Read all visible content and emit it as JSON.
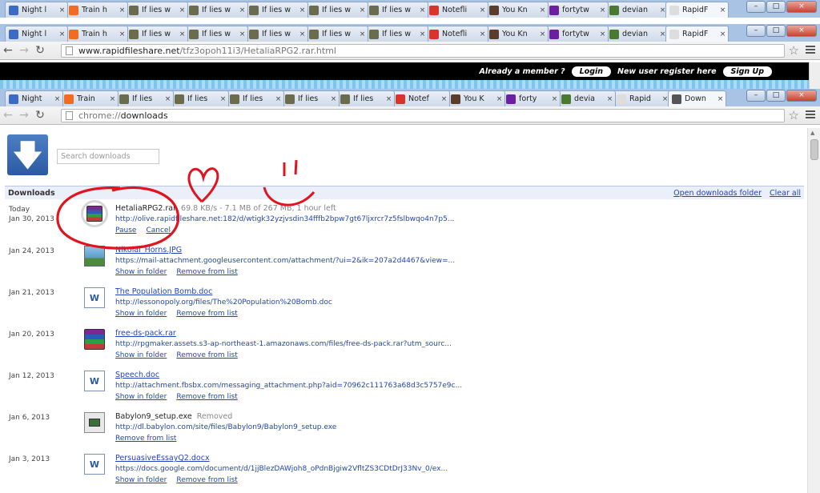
{
  "browser_outer": {
    "tabs": [
      {
        "label": "Night l",
        "icon": "doc-icon",
        "color": "#3b6bc4"
      },
      {
        "label": "Train h",
        "icon": "blogger-icon",
        "color": "#f26b22"
      },
      {
        "label": "If lies w",
        "icon": "thumbnail-icon",
        "color": "#6b6b4e"
      },
      {
        "label": "If lies w",
        "icon": "thumbnail-icon",
        "color": "#6b6b4e"
      },
      {
        "label": "If lies w",
        "icon": "thumbnail-icon",
        "color": "#6b6b4e"
      },
      {
        "label": "If lies w",
        "icon": "thumbnail-icon",
        "color": "#6b6b4e"
      },
      {
        "label": "If lies w",
        "icon": "thumbnail-icon",
        "color": "#6b6b4e"
      },
      {
        "label": "Notefli",
        "icon": "notefli-icon",
        "color": "#d9342b"
      },
      {
        "label": "You Kn",
        "icon": "photo-icon",
        "color": "#5a3d2b"
      },
      {
        "label": "fortytw",
        "icon": "yahoo-icon",
        "color": "#6b1fa3"
      },
      {
        "label": "devian",
        "icon": "deviantart-icon",
        "color": "#4a7a32"
      },
      {
        "label": "RapidF",
        "icon": "page-icon",
        "color": "#dddddd"
      }
    ],
    "url_host": "www.rapidfileshare.net",
    "url_path": "/tfz3opoh11i3/HetaliaRPG2.rar.html"
  },
  "rapidfileshare": {
    "member_text": "Already a member ?",
    "login_label": "Login",
    "register_text": "New user register here",
    "signup_label": "Sign Up"
  },
  "browser_inner": {
    "tabs": [
      {
        "label": "Night",
        "icon": "doc-icon",
        "color": "#3b6bc4"
      },
      {
        "label": "Train",
        "icon": "blogger-icon",
        "color": "#f26b22"
      },
      {
        "label": "If lies",
        "icon": "thumbnail-icon",
        "color": "#6b6b4e"
      },
      {
        "label": "If lies",
        "icon": "thumbnail-icon",
        "color": "#6b6b4e"
      },
      {
        "label": "If lies",
        "icon": "thumbnail-icon",
        "color": "#6b6b4e"
      },
      {
        "label": "If lies",
        "icon": "thumbnail-icon",
        "color": "#6b6b4e"
      },
      {
        "label": "If lies",
        "icon": "thumbnail-icon",
        "color": "#6b6b4e"
      },
      {
        "label": "Notef",
        "icon": "notefli-icon",
        "color": "#d9342b"
      },
      {
        "label": "You K",
        "icon": "photo-icon",
        "color": "#5a3d2b"
      },
      {
        "label": "forty",
        "icon": "yahoo-icon",
        "color": "#6b1fa3"
      },
      {
        "label": "devia",
        "icon": "deviantart-icon",
        "color": "#4a7a32"
      },
      {
        "label": "Rapid",
        "icon": "page-icon",
        "color": "#dddddd"
      },
      {
        "label": "Down",
        "icon": "download-icon",
        "color": "#555555"
      }
    ],
    "url_scheme": "chrome://",
    "url_path": "downloads"
  },
  "downloads": {
    "search_placeholder": "Search downloads",
    "section_title": "Downloads",
    "open_folder_label": "Open downloads folder",
    "clear_all_label": "Clear all",
    "items": [
      {
        "date_line1": "Today",
        "date_line2": "Jan 30, 2013",
        "name": "HetaliaRPG2.rar",
        "status": "69.8 KB/s - 7.1 MB of 267 MB, 1 hour left",
        "url": "http://olive.rapidfileshare.net:182/d/wtigk32yzjvsdin34fffb2bpw7gt67ljxrcr7z5fslbwqo4n7p5...",
        "action1": "Pause",
        "action2": "Cancel",
        "icon": "rar-icon",
        "in_progress": true
      },
      {
        "date_line1": "Jan 24, 2013",
        "date_line2": "",
        "name": "Nikolai_Horns.JPG",
        "status": "",
        "url": "https://mail-attachment.googleusercontent.com/attachment/?ui=2&ik=207a2d4467&view=...",
        "action1": "Show in folder",
        "action2": "Remove from list",
        "icon": "jpg-icon"
      },
      {
        "date_line1": "Jan 21, 2013",
        "date_line2": "",
        "name": "The Population Bomb.doc",
        "status": "",
        "url": "http://lessonopoly.org/files/The%20Population%20Bomb.doc",
        "action1": "Show in folder",
        "action2": "Remove from list",
        "icon": "word-icon"
      },
      {
        "date_line1": "Jan 20, 2013",
        "date_line2": "",
        "name": "free-ds-pack.rar",
        "status": "",
        "url": "http://rpgmaker.assets.s3-ap-northeast-1.amazonaws.com/files/free-ds-pack.rar?utm_sourc...",
        "action1": "Show in folder",
        "action2": "Remove from list",
        "icon": "rar-icon"
      },
      {
        "date_line1": "Jan 12, 2013",
        "date_line2": "",
        "name": "Speech.doc",
        "status": "",
        "url": "http://attachment.fbsbx.com/messaging_attachment.php?aid=70962c111763a68d3c5757e9c...",
        "action1": "Show in folder",
        "action2": "Remove from list",
        "icon": "word-icon"
      },
      {
        "date_line1": "Jan 6, 2013",
        "date_line2": "",
        "name": "Babylon9_setup.exe",
        "status": "Removed",
        "url": "http://dl.babylon.com/site/files/Babylon9/Babylon9_setup.exe",
        "action1": "Remove from list",
        "action2": "",
        "icon": "exe-icon",
        "removed": true
      },
      {
        "date_line1": "Jan 3, 2013",
        "date_line2": "",
        "name": "PersuasiveEssayQ2.docx",
        "status": "",
        "url": "https://docs.google.com/document/d/1jjBlezDAWjoh8_oPdnBjgiw2VfltZS3CDtDrJ33Nv_0/ex...",
        "action1": "Show in folder",
        "action2": "Remove from list",
        "icon": "word-icon"
      }
    ]
  }
}
